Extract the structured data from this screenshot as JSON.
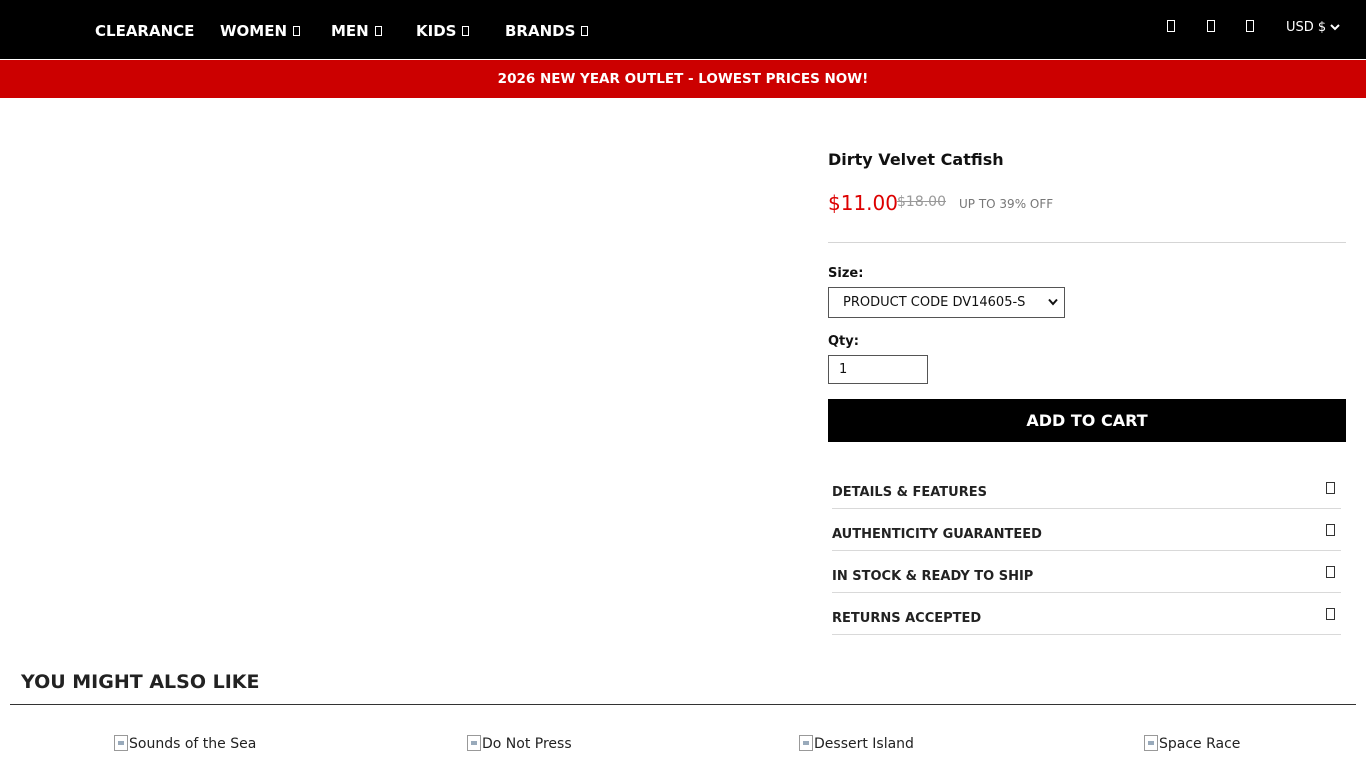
{
  "nav": {
    "items": [
      {
        "label": "CLEARANCE",
        "has_dropdown": false
      },
      {
        "label": "WOMEN",
        "has_dropdown": true
      },
      {
        "label": "MEN",
        "has_dropdown": true
      },
      {
        "label": "KIDS",
        "has_dropdown": true
      },
      {
        "label": "BRANDS",
        "has_dropdown": true
      }
    ],
    "utility_icons": [
      "search-icon",
      "account-icon",
      "cart-icon"
    ],
    "currency": "USD $"
  },
  "promo": {
    "text": "2026 NEW YEAR OUTLET - LOWEST PRICES NOW!"
  },
  "product": {
    "title": "Dirty Velvet Catfish",
    "price": "$11.00",
    "original_price": "$18.00",
    "discount": "UP TO 39% OFF",
    "size_label": "Size:",
    "size_selected": "PRODUCT CODE DV14605-S",
    "qty_label": "Qty:",
    "qty_value": "1",
    "add_to_cart": "ADD TO CART",
    "accordion": [
      {
        "label": "DETAILS & FEATURES"
      },
      {
        "label": "AUTHENTICITY GUARANTEED"
      },
      {
        "label": "IN STOCK & READY TO SHIP"
      },
      {
        "label": "RETURNS ACCEPTED"
      }
    ]
  },
  "recommendations": {
    "heading": "YOU MIGHT ALSO LIKE",
    "items": [
      {
        "alt": "Sounds of the Sea"
      },
      {
        "alt": "Do Not Press"
      },
      {
        "alt": "Dessert Island"
      },
      {
        "alt": "Space Race"
      }
    ]
  },
  "colors": {
    "nav_bg": "#000000",
    "promo_bg": "#cc0000",
    "price": "#dd0000",
    "button_bg": "#000000"
  }
}
